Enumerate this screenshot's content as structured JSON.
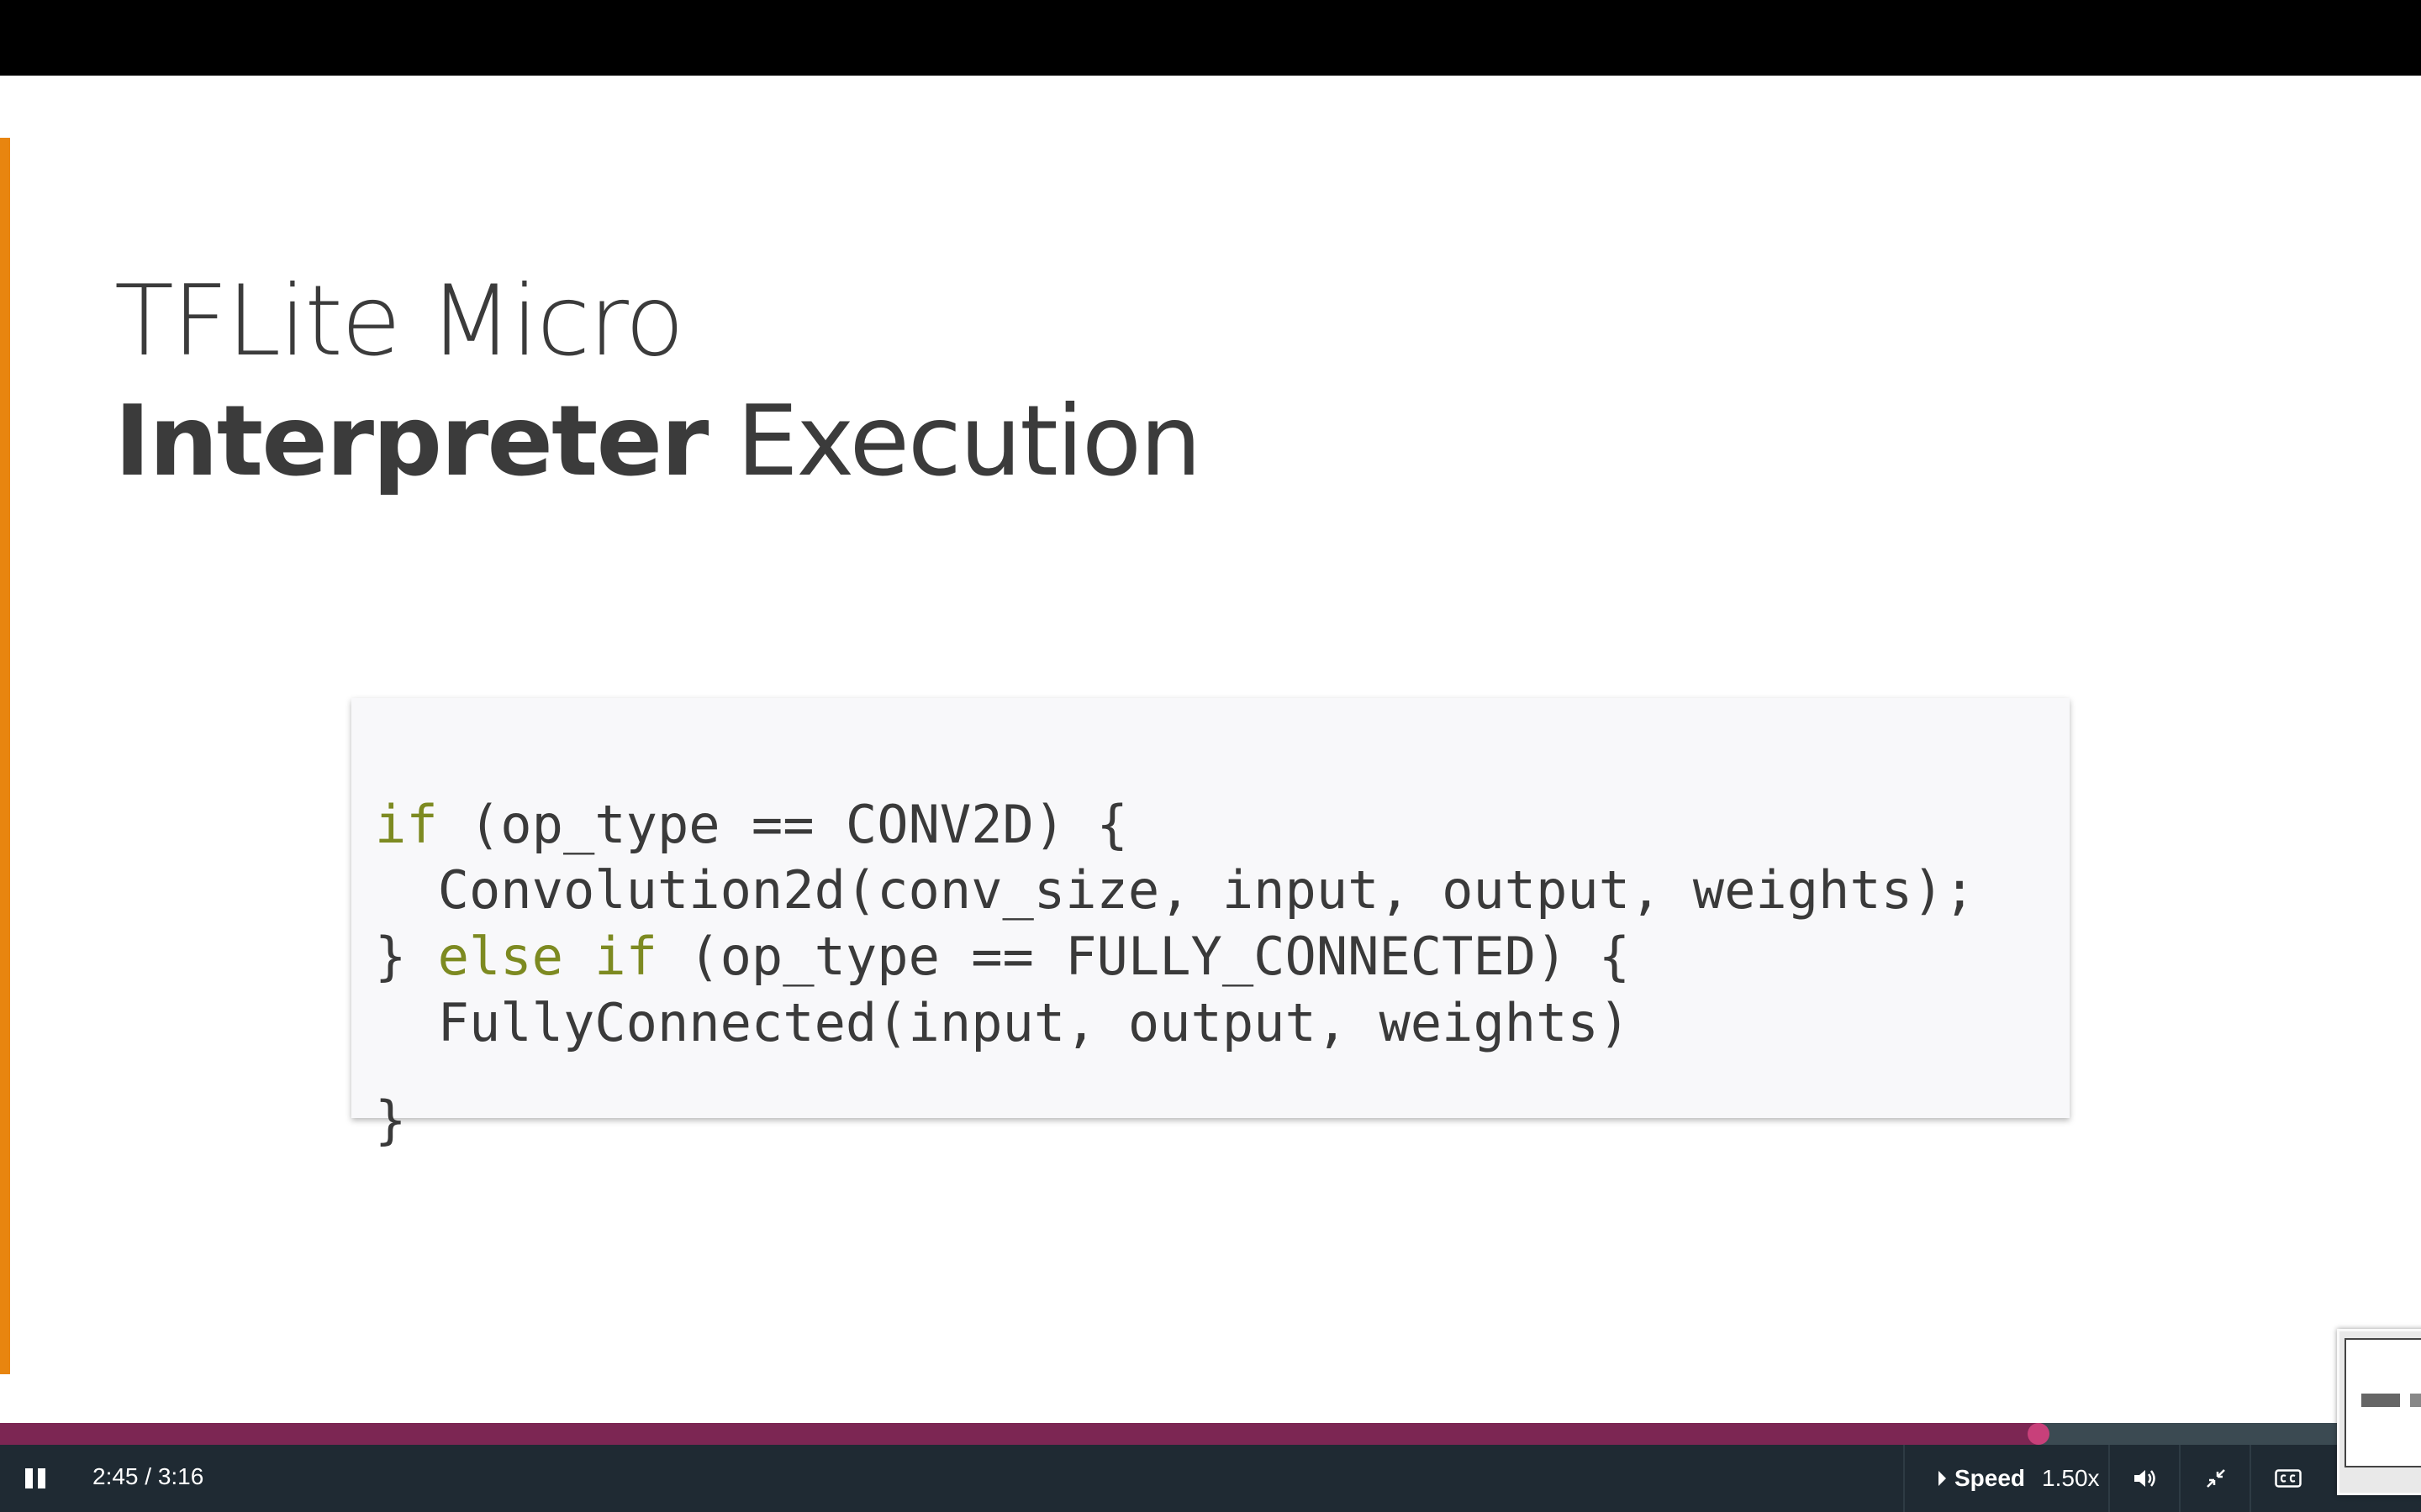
{
  "slide": {
    "title_line1": "TFLite Micro",
    "title_line2_bold": "Interpreter",
    "title_line2_rest": " Execution",
    "accent_color": "#e8850f",
    "code": {
      "keyword_color": "#7d8a21",
      "lines": [
        {
          "kw1": "if",
          "text": " (op_type == CONV2D) {"
        },
        {
          "text": "  Convolution2d(conv_size, input, output, weights);"
        },
        {
          "pre": "} ",
          "kw1": "else",
          "mid": " ",
          "kw2": "if",
          "text": " (op_type == FULLY_CONNECTED) {"
        },
        {
          "text": "  FullyConnected(input, output, weights)"
        },
        {
          "text": "}"
        }
      ]
    }
  },
  "player": {
    "time_display": "2:45 / 3:16",
    "progress_fraction": 0.842,
    "speed_label": "Speed",
    "speed_value": "1.50x",
    "pause_icon": "pause-icon",
    "volume_icon": "volume-icon",
    "exit_fullscreen_icon": "exit-fullscreen-icon",
    "captions_icon": "closed-captions-icon"
  }
}
